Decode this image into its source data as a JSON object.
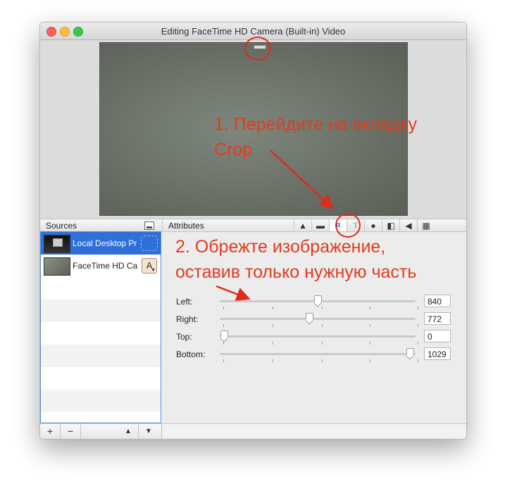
{
  "window": {
    "title": "Editing FaceTime HD Camera (Built-in) Video"
  },
  "panels": {
    "sources_label": "Sources",
    "attributes_label": "Attributes"
  },
  "tabs": [
    {
      "name": "tab-shapes",
      "icon": "shapes-icon",
      "glyph": "▲"
    },
    {
      "name": "tab-folder",
      "icon": "folder-icon",
      "glyph": "▬"
    },
    {
      "name": "tab-crop",
      "icon": "crop-icon",
      "glyph": "⌗",
      "active": true
    },
    {
      "name": "tab-text",
      "icon": "text-icon",
      "glyph": "T"
    },
    {
      "name": "tab-user",
      "icon": "person-icon",
      "glyph": "●"
    },
    {
      "name": "tab-filter",
      "icon": "split-square-icon",
      "glyph": "◧"
    },
    {
      "name": "tab-audio",
      "icon": "speaker-icon",
      "glyph": "◀"
    },
    {
      "name": "tab-film",
      "icon": "film-icon",
      "glyph": "▦"
    }
  ],
  "sources": [
    {
      "label": "Local Desktop Pr",
      "selected": true
    },
    {
      "label": "FaceTime HD Cai",
      "font_button": "A"
    }
  ],
  "footer_buttons": {
    "add": "+",
    "remove": "−",
    "move_up": "▲",
    "move_down": "▼"
  },
  "crop": [
    {
      "label": "Left:",
      "value": "840"
    },
    {
      "label": "Right:",
      "value": "772"
    },
    {
      "label": "Top:",
      "value": "0"
    },
    {
      "label": "Bottom:",
      "value": "1029"
    }
  ],
  "annotations": {
    "step1_line1": "1. Перейдите на вкладку",
    "step1_line2": "Crop",
    "step2_line1": "2. Обрежте изображение,",
    "step2_line2": "оставив только нужную часть"
  },
  "colors": {
    "annotation": "#e23b1c",
    "selection": "#2f6fd7"
  }
}
